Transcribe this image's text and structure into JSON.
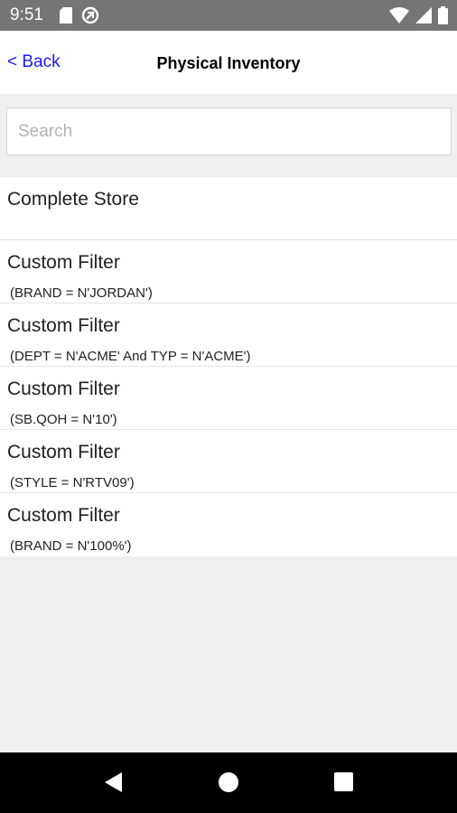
{
  "status_bar": {
    "time": "9:51",
    "left_icons": [
      "sd-card-icon",
      "data-saver-icon"
    ],
    "right_icons": [
      "wifi-icon",
      "cell-signal-icon",
      "battery-icon"
    ]
  },
  "header": {
    "back_label": "< Back",
    "title": "Physical Inventory"
  },
  "search": {
    "placeholder": "Search",
    "value": ""
  },
  "list": {
    "items": [
      {
        "title": "Complete Store",
        "subtitle": ""
      },
      {
        "title": "Custom Filter",
        "subtitle": "(BRAND = N'JORDAN')"
      },
      {
        "title": "Custom Filter",
        "subtitle": "(DEPT = N'ACME' And TYP = N'ACME')"
      },
      {
        "title": "Custom Filter",
        "subtitle": "(SB.QOH = N'10')"
      },
      {
        "title": "Custom Filter",
        "subtitle": "(STYLE = N'RTV09')"
      },
      {
        "title": "Custom Filter",
        "subtitle": "(BRAND = N'100%')"
      }
    ]
  },
  "nav_bar": {
    "buttons": [
      "back-triangle-icon",
      "home-circle-icon",
      "recents-square-icon"
    ]
  },
  "colors": {
    "status_bar": "#757575",
    "background": "#efefef",
    "link": "#1a1aff",
    "nav_bar": "#000000"
  }
}
